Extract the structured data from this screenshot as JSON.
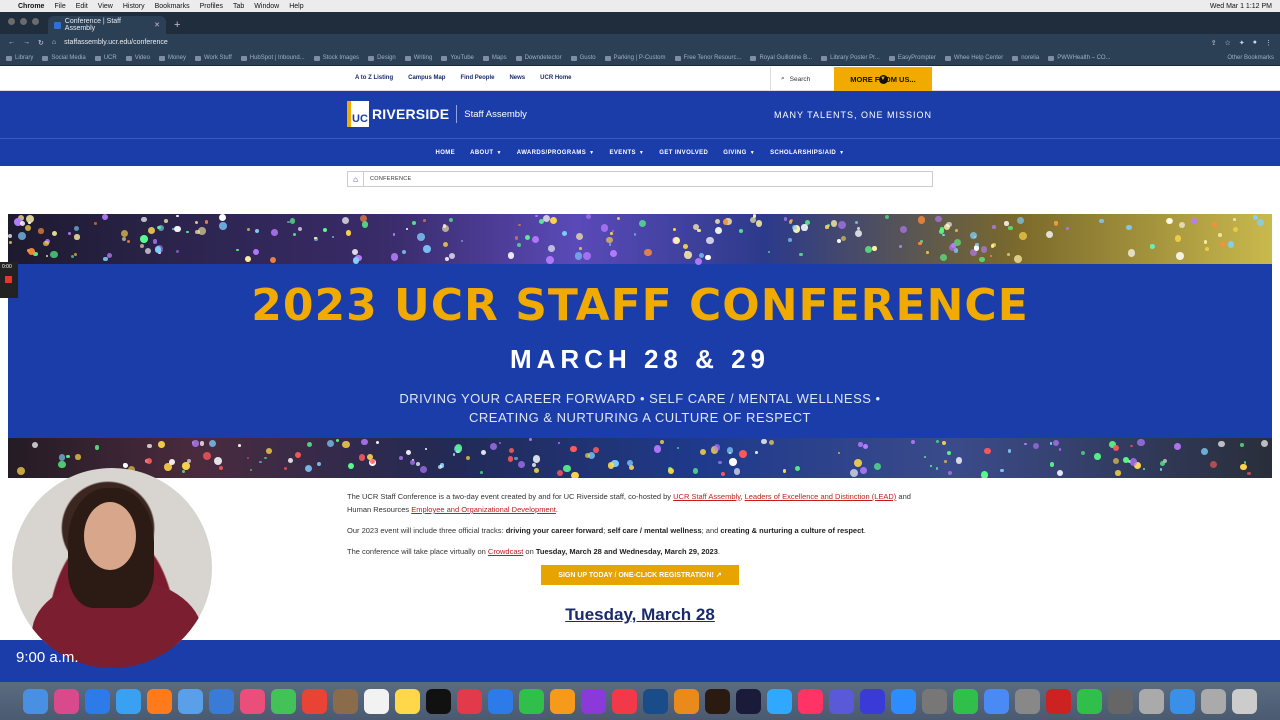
{
  "menubar": {
    "app": "Chrome",
    "items": [
      "File",
      "Edit",
      "View",
      "History",
      "Bookmarks",
      "Profiles",
      "Tab",
      "Window",
      "Help"
    ],
    "clock": "Wed Mar 1  1:12 PM"
  },
  "browser": {
    "tab_title": "Conference | Staff Assembly",
    "url": "staffassembly.ucr.edu/conference",
    "bookmarks": [
      "Library",
      "Social Media",
      "UCR",
      "Video",
      "Money",
      "Work Stuff",
      "HubSpot | Inbound...",
      "Stock Images",
      "Design",
      "Writing",
      "YouTube",
      "Maps",
      "Downdetector",
      "Gusto",
      "Parking | P-Custom",
      "Free Tenor Resourc...",
      "Royal Guillotine B...",
      "Library Poster Pr...",
      "EasyPrompter",
      "Whee Help Center",
      "norelia",
      "PWWHealth – CO..."
    ],
    "other_bookmarks": "Other Bookmarks"
  },
  "utility": {
    "links": [
      "A to Z Listing",
      "Campus Map",
      "Find People",
      "News",
      "UCR Home"
    ],
    "search_label": "Search",
    "more_label": "MORE FROM US..."
  },
  "header": {
    "logo_uc": "UC",
    "logo_riverside": "RIVERSIDE",
    "site_name": "Staff Assembly",
    "tagline": "MANY TALENTS, ONE MISSION"
  },
  "nav": [
    {
      "label": "HOME",
      "dropdown": false
    },
    {
      "label": "ABOUT",
      "dropdown": true
    },
    {
      "label": "AWARDS/PROGRAMS",
      "dropdown": true
    },
    {
      "label": "EVENTS",
      "dropdown": true
    },
    {
      "label": "GET INVOLVED",
      "dropdown": false
    },
    {
      "label": "GIVING",
      "dropdown": true
    },
    {
      "label": "SCHOLARSHIPS/AID",
      "dropdown": true
    }
  ],
  "breadcrumb": {
    "current": "CONFERENCE"
  },
  "hero": {
    "title": "2023 UCR STAFF CONFERENCE",
    "date": "MARCH 28 & 29",
    "sub1": "DRIVING YOUR CAREER FORWARD • SELF CARE / MENTAL WELLNESS •",
    "sub2": "CREATING & NURTURING A CULTURE OF RESPECT"
  },
  "content": {
    "p1_a": "The UCR Staff Conference is a two-day event created by and for UC Riverside staff, co-hosted by ",
    "p1_link1": "UCR Staff Assembly",
    "p1_b": ", ",
    "p1_link2": "Leaders of Excellence and Distinction (LEAD)",
    "p1_c": " and Human Resources ",
    "p1_link3": "Employee and Organizational Development",
    "p1_d": ".",
    "p2_a": "Our 2023 event will include three official tracks: ",
    "p2_b1": "driving your career forward",
    "p2_sep1": "; ",
    "p2_b2": "self care / mental wellness",
    "p2_sep2": "; and ",
    "p2_b3": "creating & nurturing a culture of respect",
    "p2_end": ".",
    "p3_a": "The conference will take place virtually on ",
    "p3_link": "Crowdcast",
    "p3_b": " on ",
    "p3_bold": "Tuesday, March 28 and Wednesday, March 29, 2023",
    "p3_end": ".",
    "cta": "SIGN UP TODAY / ONE-CLICK REGISTRATION! ↗",
    "day_heading": "Tuesday, March 28"
  },
  "overlay": {
    "recording_time": "0:00",
    "timecode": "9:00 a.m."
  },
  "colors": {
    "ucr_blue": "#1a3daa",
    "ucr_gold": "#f1ab00",
    "link_red": "#c01d1d"
  }
}
